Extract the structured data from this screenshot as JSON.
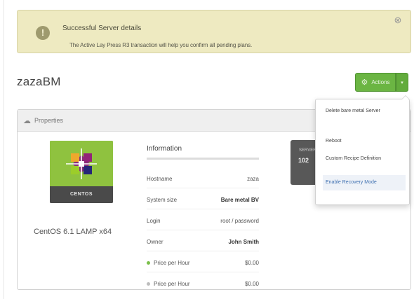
{
  "alert": {
    "badge": "!",
    "title": "Successful Server details",
    "body": "The Active Lay Press R3 transaction will help you confirm all pending plans.",
    "close": "⊗"
  },
  "page": {
    "title": "zazaBM"
  },
  "actions": {
    "main_label": "Actions",
    "gear": "⚙",
    "caret": "▾"
  },
  "menu": {
    "items": [
      {
        "label": "Delete bare metal Server"
      },
      {
        "label": "Reboot"
      },
      {
        "label": "Custom Recipe Definition"
      },
      {
        "label": "Enable Recovery Mode"
      }
    ]
  },
  "panel": {
    "heading_icon": "☁",
    "heading": "Properties"
  },
  "os": {
    "logo_text": "CENTOS",
    "name": "CentOS 6.1 LAMP x64",
    "colors": {
      "tile": "#8fc23f",
      "band": "#4a4a4a"
    }
  },
  "information": {
    "title": "Information",
    "rows": [
      {
        "label": "Hostname",
        "value": "zaza"
      },
      {
        "label": "System size",
        "value": "Bare metal BV"
      },
      {
        "label": "Login",
        "value": "root / password"
      },
      {
        "label": "Owner",
        "value": "John Smith"
      },
      {
        "label": "Price per Hour",
        "value": "$0.00",
        "dot": "#7bbf4a"
      },
      {
        "label": "Price per Hour",
        "value": "$0.00",
        "dot": "#bdbdbd"
      }
    ]
  },
  "side_box": {
    "caption": "SERVER",
    "value": "102"
  }
}
